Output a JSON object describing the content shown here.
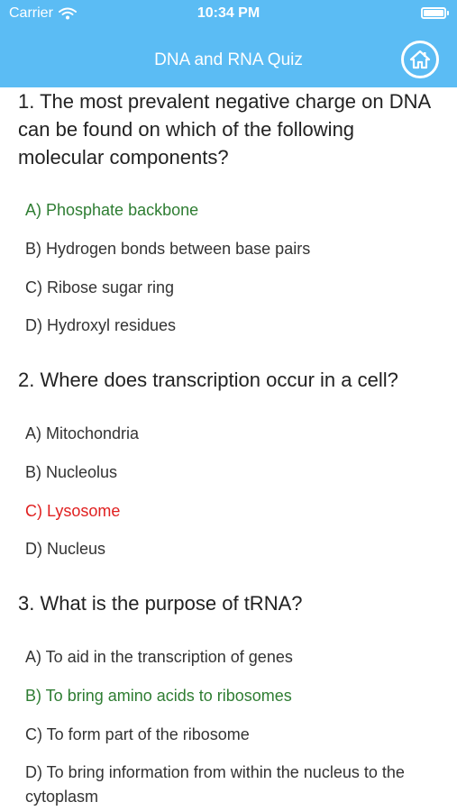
{
  "status_bar": {
    "carrier": "Carrier",
    "time": "10:34 PM",
    "icons": [
      "wifi-icon",
      "battery-icon"
    ]
  },
  "header": {
    "title": "DNA and RNA Quiz",
    "home_icon": "home-icon",
    "color": "#5bbcf4"
  },
  "colors": {
    "correct": "#2e7d32",
    "wrong": "#e02020"
  },
  "questions": [
    {
      "text": "1. The most prevalent negative charge on DNA can be found on which of the following molecular components?",
      "options": [
        {
          "label": "A) Phosphate backbone",
          "state": "correct"
        },
        {
          "label": "B) Hydrogen bonds between base pairs",
          "state": "none"
        },
        {
          "label": "C) Ribose sugar ring",
          "state": "none"
        },
        {
          "label": "D) Hydroxyl residues",
          "state": "none"
        }
      ]
    },
    {
      "text": "2. Where does transcription occur in a cell?",
      "options": [
        {
          "label": "A) Mitochondria",
          "state": "none"
        },
        {
          "label": "B) Nucleolus",
          "state": "none"
        },
        {
          "label": "C) Lysosome",
          "state": "wrong"
        },
        {
          "label": "D) Nucleus",
          "state": "none"
        }
      ]
    },
    {
      "text": "3. What is the purpose of tRNA?",
      "options": [
        {
          "label": "A) To aid in the transcription of genes",
          "state": "none"
        },
        {
          "label": "B) To bring amino acids to ribosomes",
          "state": "correct"
        },
        {
          "label": "C) To form part of the ribosome",
          "state": "none"
        },
        {
          "label": "D) To bring information from within the nucleus to the cytoplasm",
          "state": "none"
        }
      ]
    }
  ]
}
